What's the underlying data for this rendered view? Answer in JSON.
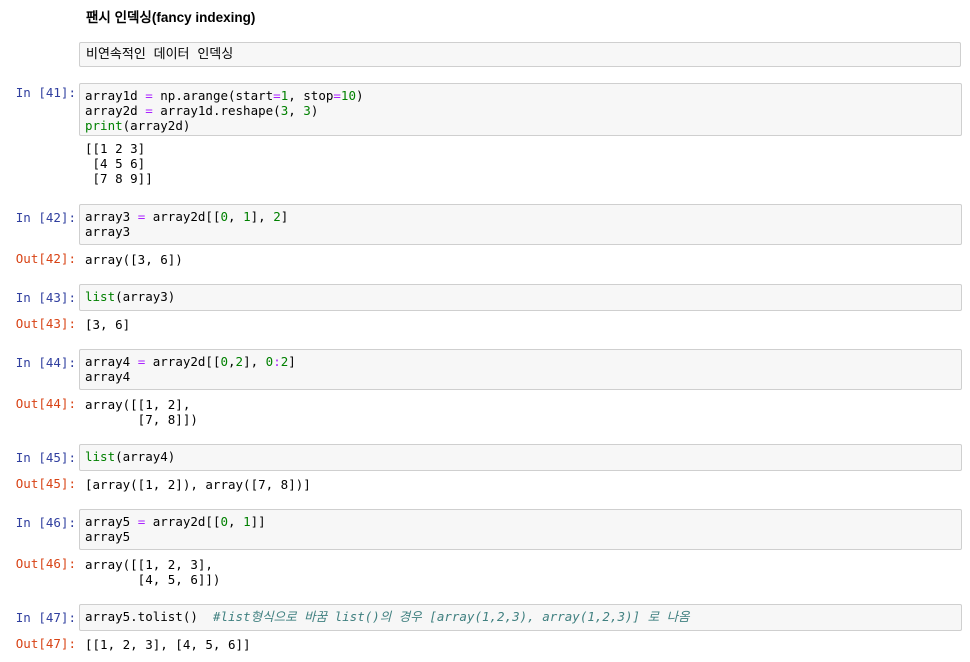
{
  "markdown": {
    "heading": "팬시 인덱싱(fancy indexing)",
    "box_text": "비연속적인 데이터 인덱싱"
  },
  "cells": [
    {
      "in_prompt": "In [41]:",
      "code": [
        [
          [
            "array1d ",
            ""
          ],
          [
            "=",
            "op"
          ],
          [
            " np.arange(start",
            ""
          ],
          [
            "=",
            "op"
          ],
          [
            "1",
            "num"
          ],
          [
            ", stop",
            ""
          ],
          [
            "=",
            "op"
          ],
          [
            "10",
            "num"
          ],
          [
            ")",
            ""
          ]
        ],
        [
          [
            "array2d ",
            ""
          ],
          [
            "=",
            "op"
          ],
          [
            " array1d.reshape(",
            ""
          ],
          [
            "3",
            "num"
          ],
          [
            ", ",
            ""
          ],
          [
            "3",
            "num"
          ],
          [
            ")",
            ""
          ]
        ],
        [
          [
            "print",
            "kw-green"
          ],
          [
            "(array2d)",
            ""
          ]
        ]
      ],
      "out_prompt": "",
      "output": "[[1 2 3]\n [4 5 6]\n [7 8 9]]"
    },
    {
      "in_prompt": "In [42]:",
      "code": [
        [
          [
            "array3 ",
            ""
          ],
          [
            "=",
            "op"
          ],
          [
            " array2d[[",
            ""
          ],
          [
            "0",
            "num"
          ],
          [
            ", ",
            ""
          ],
          [
            "1",
            "num"
          ],
          [
            "], ",
            ""
          ],
          [
            "2",
            "num"
          ],
          [
            "]",
            ""
          ]
        ],
        [
          [
            "array3",
            ""
          ]
        ]
      ],
      "out_prompt": "Out[42]:",
      "output": "array([3, 6])"
    },
    {
      "in_prompt": "In [43]:",
      "code": [
        [
          [
            "list",
            "kw-green"
          ],
          [
            "(array3)",
            ""
          ]
        ]
      ],
      "out_prompt": "Out[43]:",
      "output": "[3, 6]"
    },
    {
      "in_prompt": "In [44]:",
      "code": [
        [
          [
            "array4 ",
            ""
          ],
          [
            "=",
            "op"
          ],
          [
            " array2d[[",
            ""
          ],
          [
            "0",
            "num"
          ],
          [
            ",",
            ""
          ],
          [
            "2",
            "num"
          ],
          [
            "], ",
            ""
          ],
          [
            "0",
            "num"
          ],
          [
            ":",
            "op"
          ],
          [
            "2",
            "num"
          ],
          [
            "]",
            ""
          ]
        ],
        [
          [
            "array4",
            ""
          ]
        ]
      ],
      "out_prompt": "Out[44]:",
      "output": "array([[1, 2],\n       [7, 8]])"
    },
    {
      "in_prompt": "In [45]:",
      "code": [
        [
          [
            "list",
            "kw-green"
          ],
          [
            "(array4)",
            ""
          ]
        ]
      ],
      "out_prompt": "Out[45]:",
      "output": "[array([1, 2]), array([7, 8])]"
    },
    {
      "in_prompt": "In [46]:",
      "code": [
        [
          [
            "array5 ",
            ""
          ],
          [
            "=",
            "op"
          ],
          [
            " array2d[[",
            ""
          ],
          [
            "0",
            "num"
          ],
          [
            ", ",
            ""
          ],
          [
            "1",
            "num"
          ],
          [
            "]]",
            ""
          ]
        ],
        [
          [
            "array5",
            ""
          ]
        ]
      ],
      "out_prompt": "Out[46]:",
      "output": "array([[1, 2, 3],\n       [4, 5, 6]])"
    },
    {
      "in_prompt": "In [47]:",
      "code": [
        [
          [
            "array5.tolist()  ",
            ""
          ],
          [
            "#list형식으로 바꿈 list()의 경우 [array(1,2,3), array(1,2,3)] 로 나옴",
            "cmt"
          ]
        ]
      ],
      "out_prompt": "Out[47]:",
      "output": "[[1, 2, 3], [4, 5, 6]]"
    }
  ]
}
